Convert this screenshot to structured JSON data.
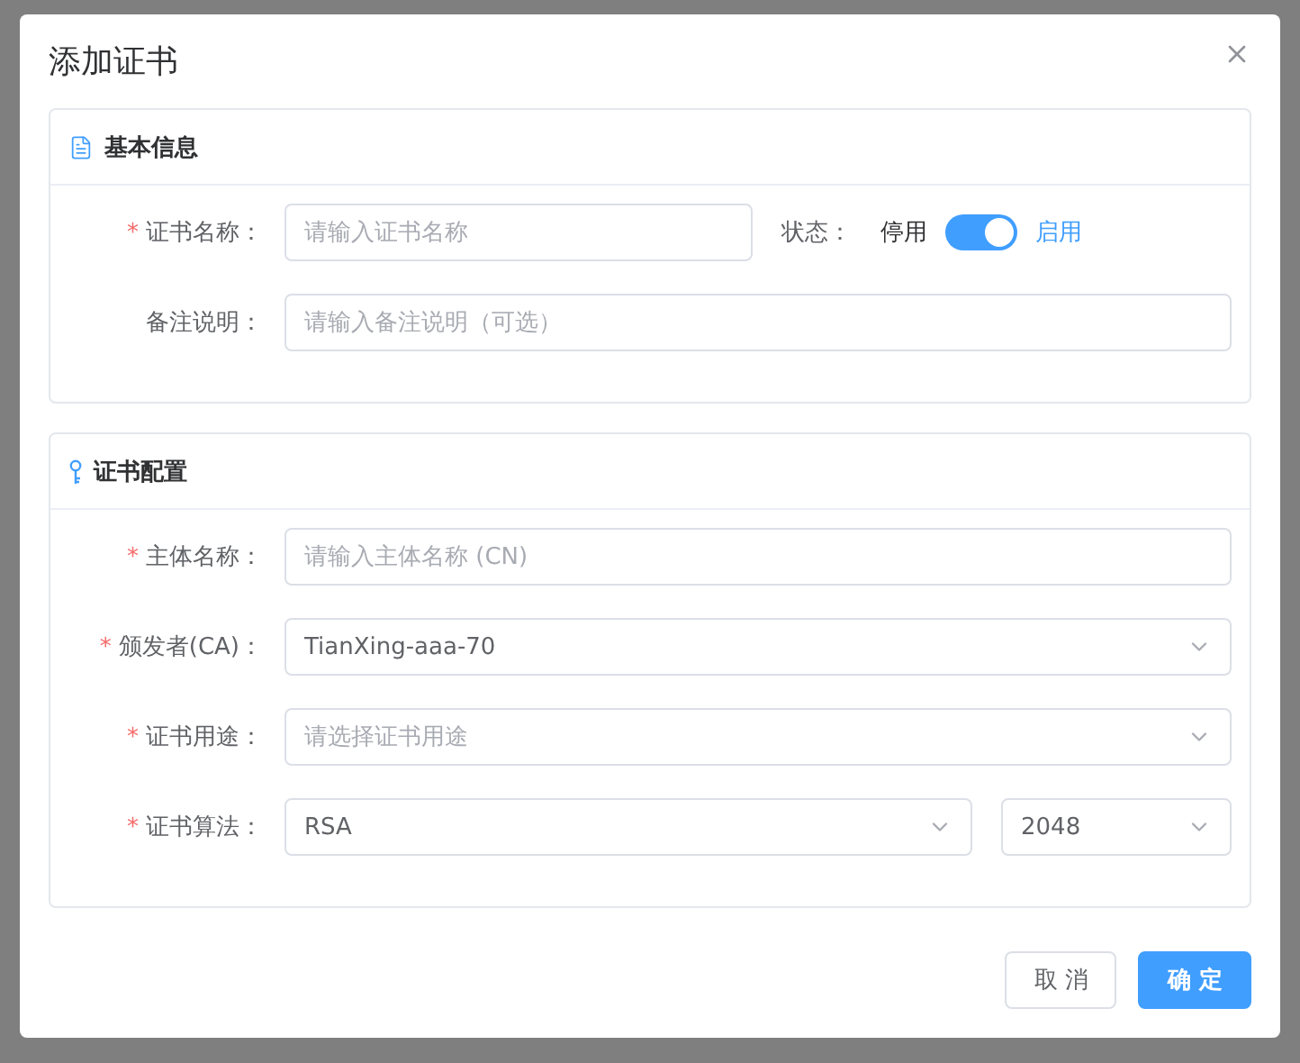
{
  "dialog": {
    "title": "添加证书",
    "sections": [
      {
        "title": "基本信息",
        "rows": [
          {
            "label": "证书名称：",
            "marker": "*",
            "fields": [
              {
                "kind": "input",
                "placeholder": "请输入证书名称"
              },
              {
                "kind": "switch",
                "label": "状态：",
                "off_text": "停用",
                "on_text": "启用",
                "on": true
              }
            ]
          },
          {
            "label": "备注说明：",
            "fields": [
              {
                "kind": "input",
                "placeholder": "请输入备注说明（可选）"
              }
            ]
          }
        ]
      },
      {
        "title": "证书配置",
        "rows": [
          {
            "label": "主体名称：",
            "marker": "*",
            "fields": [
              {
                "kind": "input",
                "placeholder": "请输入主体名称 (CN)"
              }
            ]
          },
          {
            "label": "颁发者(CA)：",
            "marker": "*",
            "fields": [
              {
                "kind": "select",
                "value": "TianXing-aaa-70"
              }
            ]
          },
          {
            "label": "证书用途：",
            "marker": "*",
            "fields": [
              {
                "kind": "select",
                "placeholder": "请选择证书用途"
              }
            ]
          },
          {
            "label": "证书算法：",
            "marker": "*",
            "fields": [
              {
                "kind": "select",
                "value": "RSA"
              },
              {
                "kind": "select",
                "value": "2048"
              }
            ]
          }
        ]
      }
    ],
    "buttons": [
      {
        "label": "取 消",
        "kind": "default"
      },
      {
        "label": "确 定",
        "kind": "primary"
      }
    ]
  }
}
